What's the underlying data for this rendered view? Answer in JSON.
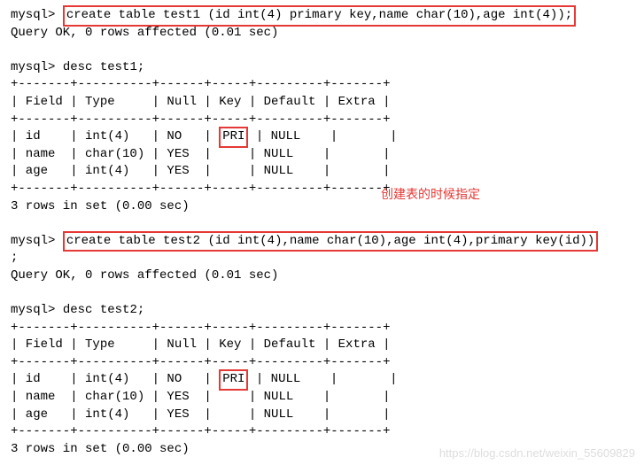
{
  "block1": {
    "prompt": "mysql>",
    "cmd": "create table test1 (id int(4) primary key,name char(10),age int(4));",
    "result": "Query OK, 0 rows affected (0.01 sec)"
  },
  "desc1": {
    "prompt": "mysql>",
    "cmd": "desc test1;",
    "sep_top": "+-------+----------+------+-----+---------+-------+",
    "header": "| Field | Type     | Null | Key | Default | Extra |",
    "sep_mid": "+-------+----------+------+-----+---------+-------+",
    "row1_a": "| id    | int(4)   | NO   | ",
    "row1_pri": "PRI",
    "row1_b": " | NULL    |       |",
    "row2": "| name  | char(10) | YES  |     | NULL    |       |",
    "row3": "| age   | int(4)   | YES  |     | NULL    |       |",
    "sep_bot": "+-------+----------+------+-----+---------+-------+",
    "result": "3 rows in set (0.00 sec)"
  },
  "annotation1": "创建表的时候指定",
  "block2": {
    "prompt": "mysql>",
    "cmd": "create table test2 (id int(4),name char(10),age int(4),primary key(id))",
    "suffix": ";",
    "result": "Query OK, 0 rows affected (0.01 sec)"
  },
  "desc2": {
    "prompt": "mysql>",
    "cmd": "desc test2;",
    "sep_top": "+-------+----------+------+-----+---------+-------+",
    "header": "| Field | Type     | Null | Key | Default | Extra |",
    "sep_mid": "+-------+----------+------+-----+---------+-------+",
    "row1_a": "| id    | int(4)   | NO   | ",
    "row1_pri": "PRI",
    "row1_b": " | NULL    |       |",
    "row2": "| name  | char(10) | YES  |     | NULL    |       |",
    "row3": "| age   | int(4)   | YES  |     | NULL    |       |",
    "sep_bot": "+-------+----------+------+-----+---------+-------+",
    "result": "3 rows in set (0.00 sec)"
  },
  "watermark": "https://blog.csdn.net/weixin_55609829"
}
